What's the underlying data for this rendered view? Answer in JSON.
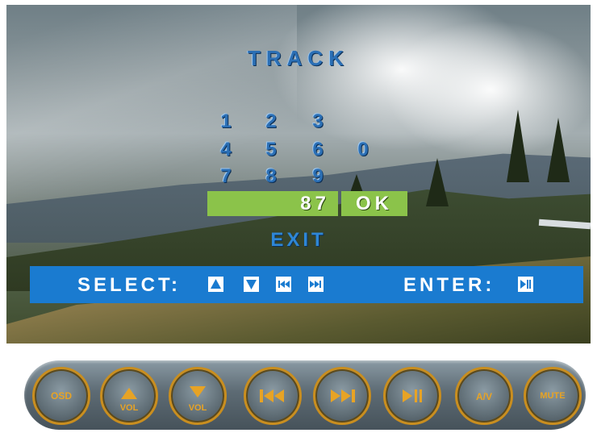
{
  "title": "TRACK",
  "keypad": {
    "row1": [
      "1",
      "2",
      "3"
    ],
    "row2": [
      "4",
      "5",
      "6",
      "0"
    ],
    "row3": [
      "7",
      "8",
      "9"
    ]
  },
  "entry": {
    "value": "87",
    "ok_label": "OK"
  },
  "exit_label": "EXIT",
  "help": {
    "select_label": "SELECT:",
    "enter_label": "ENTER:"
  },
  "icons": {
    "select_keys": [
      "up-arrow-icon",
      "down-arrow-icon",
      "previous-track-icon",
      "next-track-icon"
    ],
    "enter_key": "play-pause-icon"
  },
  "panel_buttons": [
    {
      "name": "osd-button",
      "label": "OSD"
    },
    {
      "name": "vol-up-button",
      "label": "VOL"
    },
    {
      "name": "vol-down-button",
      "label": "VOL"
    },
    {
      "name": "previous-track-button",
      "label": ""
    },
    {
      "name": "next-track-button",
      "label": ""
    },
    {
      "name": "play-pause-button",
      "label": ""
    },
    {
      "name": "av-button",
      "label": "A/V"
    },
    {
      "name": "mute-button",
      "label": "MUTE"
    }
  ],
  "colors": {
    "title": "#2b6fb5",
    "entry_bar": "#8bc34a",
    "help_bar": "#1a7bd0",
    "button_ring": "#c98e1f",
    "button_label": "#e7a325"
  }
}
